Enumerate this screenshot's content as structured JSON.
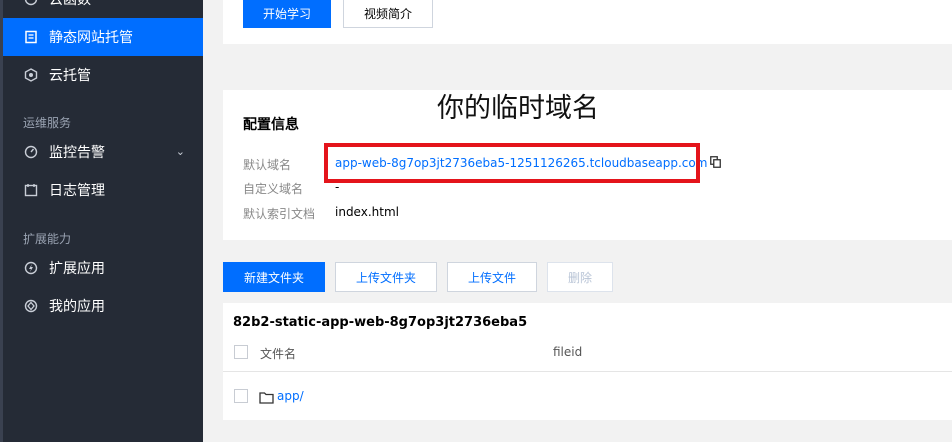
{
  "sidebar": {
    "items": [
      {
        "label": "云函数",
        "icon": "cloud-function-icon"
      },
      {
        "label": "静态网站托管",
        "icon": "document-icon"
      },
      {
        "label": "云托管",
        "icon": "hexagon-icon"
      },
      {
        "label": "监控告警",
        "icon": "monitor-icon"
      },
      {
        "label": "日志管理",
        "icon": "calendar-icon"
      },
      {
        "label": "扩展应用",
        "icon": "extension-icon"
      },
      {
        "label": "我的应用",
        "icon": "my-app-icon"
      }
    ],
    "sections": [
      "运维服务",
      "扩展能力"
    ],
    "active_color": "#006eff"
  },
  "top_card": {
    "start_button": "开始学习",
    "video_button": "视频简介"
  },
  "annotation": "你的临时域名",
  "config": {
    "title": "配置信息",
    "rows": [
      {
        "label": "默认域名",
        "value": "app-web-8g7op3jt2736eba5-1251126265.tcloudbaseapp.com"
      },
      {
        "label": "自定义域名",
        "value": "-"
      },
      {
        "label": "默认索引文档",
        "value": "index.html"
      }
    ]
  },
  "toolbar": {
    "new_folder": "新建文件夹",
    "upload_folder": "上传文件夹",
    "upload_file": "上传文件",
    "delete": "删除"
  },
  "file_table": {
    "bucket": "82b2-static-app-web-8g7op3jt2736eba5",
    "columns": [
      "文件名",
      "fileid"
    ],
    "rows": [
      {
        "name": "app/"
      }
    ]
  }
}
